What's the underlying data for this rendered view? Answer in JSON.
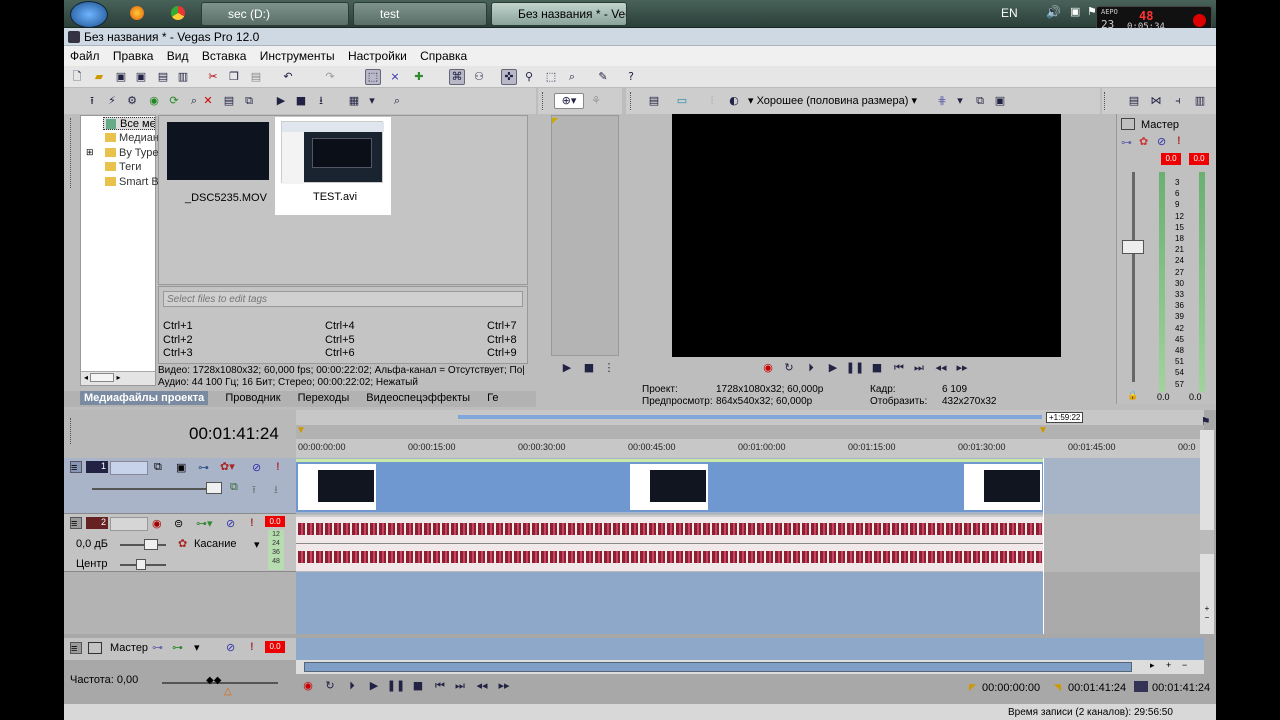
{
  "taskbar": {
    "tasks": [
      "sec (D:)",
      "test",
      "Без названия * - Vega..."
    ],
    "lang": "EN",
    "overlay": {
      "top": "АЕРО",
      "left": "23",
      "right": "48",
      "time": "0:05:34"
    }
  },
  "window": {
    "title": "Без названия * - Vegas Pro 12.0"
  },
  "menu": [
    "Файл",
    "Правка",
    "Вид",
    "Вставка",
    "Инструменты",
    "Настройки",
    "Справка"
  ],
  "explorer": {
    "tree": [
      "Все мед",
      "Медиан",
      "By Type",
      "Теги",
      "Smart B"
    ],
    "files": [
      {
        "name": "_DSC5235.MOV"
      },
      {
        "name": "TEST.avi"
      }
    ],
    "tags_placeholder": "Select files to edit tags",
    "shortcuts": [
      "Ctrl+1",
      "Ctrl+4",
      "Ctrl+7",
      "Ctrl+2",
      "Ctrl+5",
      "Ctrl+8",
      "Ctrl+3",
      "Ctrl+6",
      "Ctrl+9"
    ],
    "info_line1": "Видео: 1728x1080x32; 60,000 fps; 00:00:22:02; Альфа-канал = Отсутствует; По|",
    "info_line2": "Аудио: 44 100 Гц; 16 Бит; Стерео; 00:00:22:02; Нежатый",
    "tabs": [
      "Медиафайлы проекта",
      "Проводник",
      "Переходы",
      "Видеоспецэффекты",
      "Ге"
    ]
  },
  "preview": {
    "quality": "Хорошее (половина размера)",
    "project_label": "Проект:",
    "project_value": "1728x1080x32; 60,000p",
    "preview_label": "Предпросмотр:",
    "preview_value": "864x540x32; 60,000p",
    "frame_label": "Кадр:",
    "frame_value": "6 109",
    "display_label": "Отобразить:",
    "display_value": "432x270x32"
  },
  "mixer": {
    "title": "Мастер",
    "left_level": "0.0",
    "right_level": "0.0",
    "scale": [
      "3",
      "6",
      "9",
      "12",
      "15",
      "18",
      "21",
      "24",
      "27",
      "30",
      "33",
      "36",
      "39",
      "42",
      "45",
      "48",
      "51",
      "54",
      "57"
    ],
    "bottom_left": "0.0",
    "bottom_right": "0.0"
  },
  "timeline": {
    "cursor_time": "00:01:41:24",
    "end_marker": "+1:59:22",
    "ruler": [
      "00:00:00:00",
      "00:00:15:00",
      "00:00:30:00",
      "00:00:45:00",
      "00:01:00:00",
      "00:01:15:00",
      "00:01:30:00",
      "00:01:45:00",
      "00:0"
    ],
    "video_track": {
      "number": "1"
    },
    "audio_track": {
      "number": "2",
      "volume": "0,0 дБ",
      "pan": "Центр",
      "mode": "Касание",
      "level": "0.0",
      "meter": [
        "12",
        "24",
        "36",
        "48"
      ]
    },
    "master": {
      "label": "Мастер",
      "level": "0.0"
    },
    "rate": "Частота: 0,00",
    "time_in": "00:00:00:00",
    "time_out": "00:01:41:24",
    "time_len": "00:01:41:24",
    "status": "Время записи (2 каналов): 29:56:50"
  }
}
